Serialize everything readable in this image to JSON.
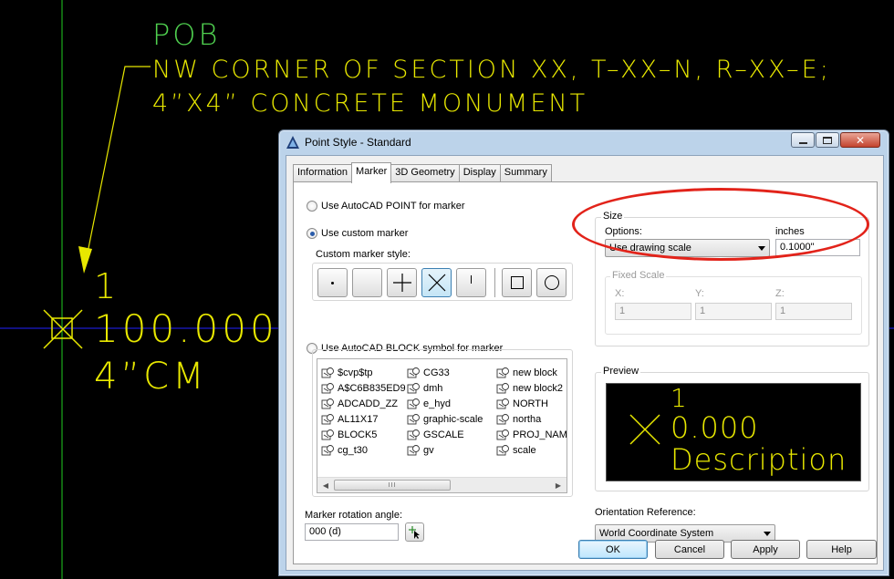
{
  "cad": {
    "pob_label": "POB",
    "callout_line1": "NW CORNER OF SECTION XX, T–XX–N, R–XX–E;",
    "callout_line2": "4”X4” CONCRETE MONUMENT",
    "point_number": "1",
    "point_elevation": "100.000",
    "point_description": "4”CM",
    "colors": {
      "background": "#000000",
      "pob": "#4fd04f",
      "text": "#e8e800",
      "crosshair_x": "#2222ff",
      "crosshair_y": "#22cc22"
    }
  },
  "dialog": {
    "title": "Point Style - Standard",
    "tabs": [
      "Information",
      "Marker",
      "3D Geometry",
      "Display",
      "Summary"
    ],
    "active_tab": "Marker",
    "marker": {
      "radio_autocad_point": "Use AutoCAD POINT for marker",
      "radio_custom": "Use custom marker",
      "custom_style_label": "Custom marker style:",
      "custom_styles": [
        "dot-icon",
        "none-icon",
        "plus-icon",
        "x-icon",
        "tick-icon",
        "square-icon",
        "circle-icon"
      ],
      "selected_style": "x-icon",
      "radio_block": "Use AutoCAD BLOCK symbol for marker",
      "blocks": [
        [
          "$cvp$tp",
          "CG33",
          "new block"
        ],
        [
          "A$C6B835ED9",
          "dmh",
          "new block2"
        ],
        [
          "ADCADD_ZZ",
          "e_hyd",
          "NORTH"
        ],
        [
          "AL11X17",
          "graphic-scale",
          "northa"
        ],
        [
          "BLOCK5",
          "GSCALE",
          "PROJ_NAM"
        ],
        [
          "cg_t30",
          "gv",
          "scale"
        ]
      ],
      "rotation_label": "Marker rotation angle:",
      "rotation_value": "000 (d)"
    },
    "size": {
      "group_label": "Size",
      "options_label": "Options:",
      "options_value": "Use drawing scale",
      "units_label": "inches",
      "units_value": "0.1000\"",
      "fixed_scale_label": "Fixed Scale",
      "x_label": "X:",
      "x_value": "1",
      "y_label": "Y:",
      "y_value": "1",
      "z_label": "Z:",
      "z_value": "1"
    },
    "preview": {
      "label": "Preview",
      "number": "1",
      "elevation": "0.000",
      "description": "Description"
    },
    "orientation": {
      "label": "Orientation Reference:",
      "value": "World Coordinate System"
    },
    "buttons": {
      "ok": "OK",
      "cancel": "Cancel",
      "apply": "Apply",
      "help": "Help"
    }
  },
  "annotation_color": "#e2231a"
}
